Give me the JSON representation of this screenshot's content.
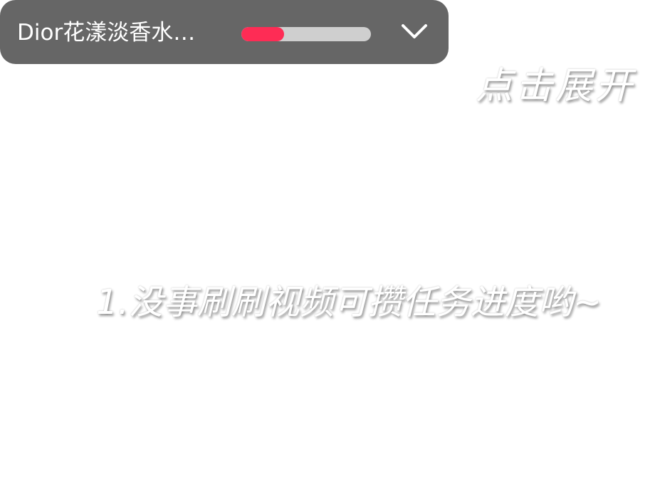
{
  "task_bar": {
    "title": "Dior花漾淡香水…",
    "progress": 0.33,
    "progress_fill_color": "#fe2c55",
    "progress_track_color": "#cfcfcf",
    "background_color": "#666666",
    "expand_icon": "chevron-down-icon"
  },
  "overlay": {
    "expand_hint": "点击展开",
    "task_hint": "1.没事刷刷视频可攒任务进度哟~"
  }
}
